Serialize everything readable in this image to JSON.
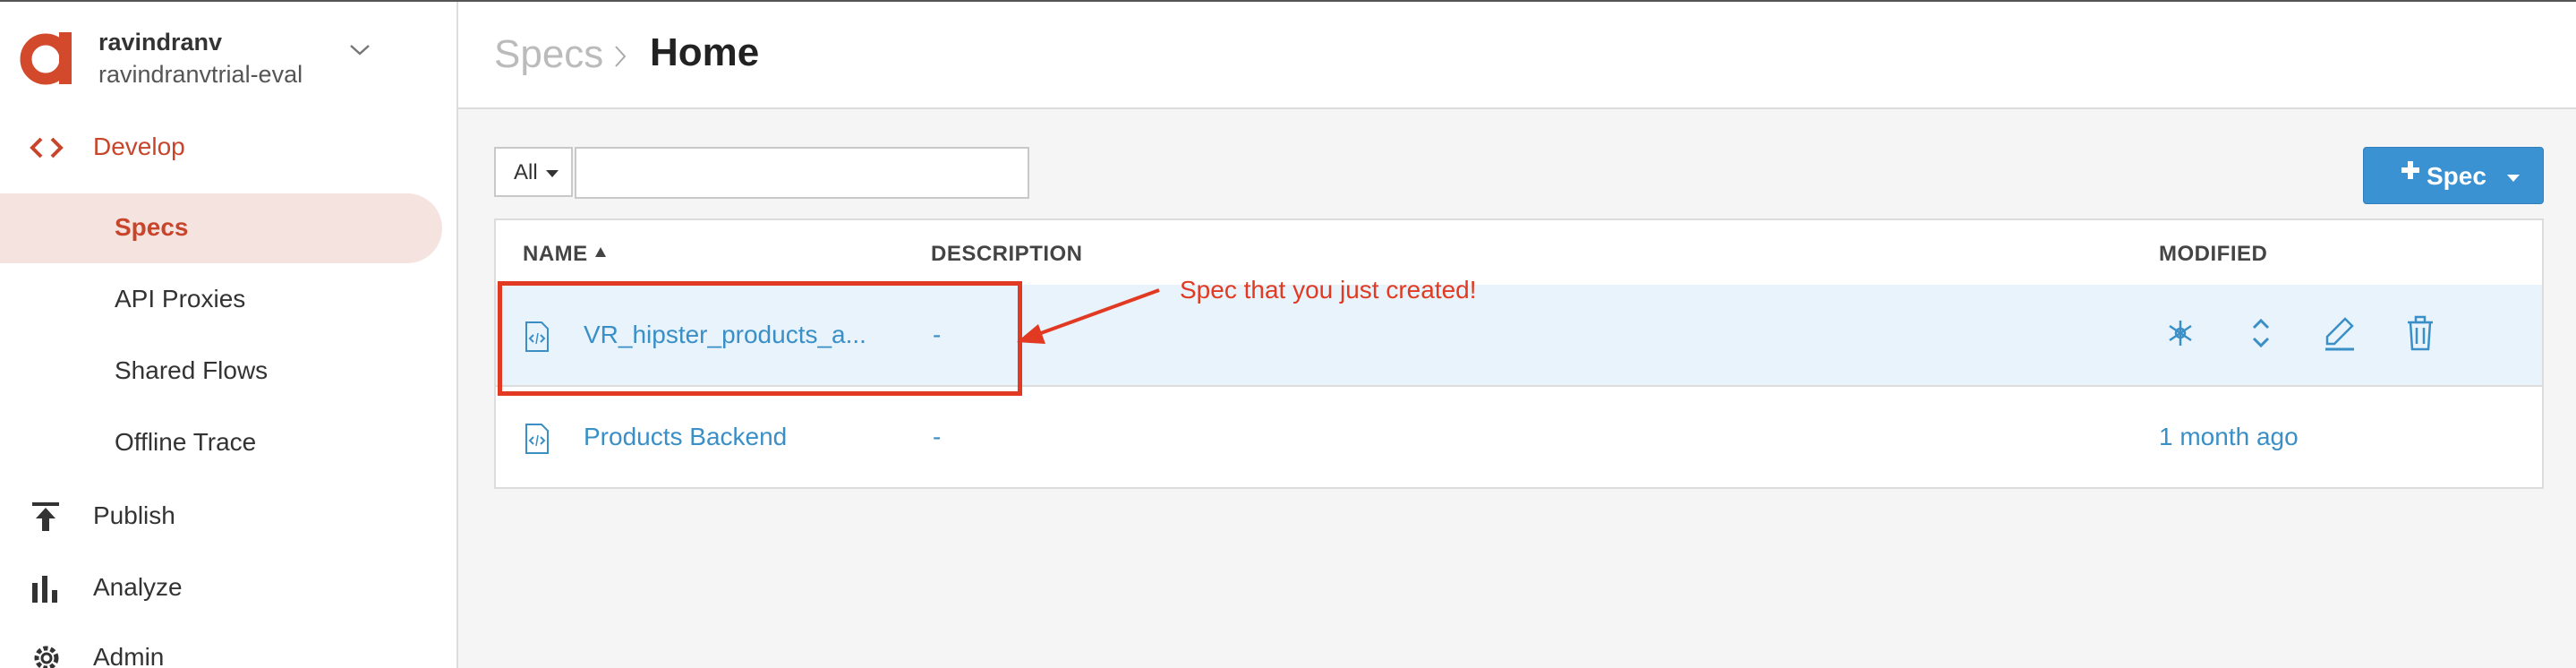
{
  "account": {
    "user": "ravindranv",
    "org": "ravindranvtrial-eval",
    "logo_icon": "apigee-a-logo",
    "brand_color": "#d24a2b"
  },
  "sidebar": {
    "develop": {
      "label": "Develop",
      "icon": "code-brackets-icon"
    },
    "sub_items": [
      {
        "label": "Specs",
        "selected": true
      },
      {
        "label": "API Proxies",
        "selected": false
      },
      {
        "label": "Shared Flows",
        "selected": false
      },
      {
        "label": "Offline Trace",
        "selected": false
      }
    ],
    "publish": {
      "label": "Publish",
      "icon": "upload-icon"
    },
    "analyze": {
      "label": "Analyze",
      "icon": "bar-chart-icon"
    },
    "admin": {
      "label": "Admin",
      "icon": "gear-icon"
    }
  },
  "breadcrumb": {
    "root": "Specs",
    "current": "Home"
  },
  "filter": {
    "selected": "All",
    "value": ""
  },
  "add_button": {
    "label": "Spec"
  },
  "table": {
    "headers": {
      "name": "NAME",
      "description": "DESCRIPTION",
      "modified": "MODIFIED"
    },
    "rows": [
      {
        "name": "VR_hipster_products_a...",
        "description": "-",
        "modified": ""
      },
      {
        "name": "Products Backend",
        "description": "-",
        "modified": "1 month ago"
      }
    ]
  },
  "annotation": {
    "text": "Spec that you just created!",
    "color": "#e23a22"
  },
  "colors": {
    "accent_blue": "#3b92d2",
    "link_blue": "#3a8fc7",
    "selected_bg": "#f4e3df",
    "row_highlight": "#e8f3fb"
  }
}
